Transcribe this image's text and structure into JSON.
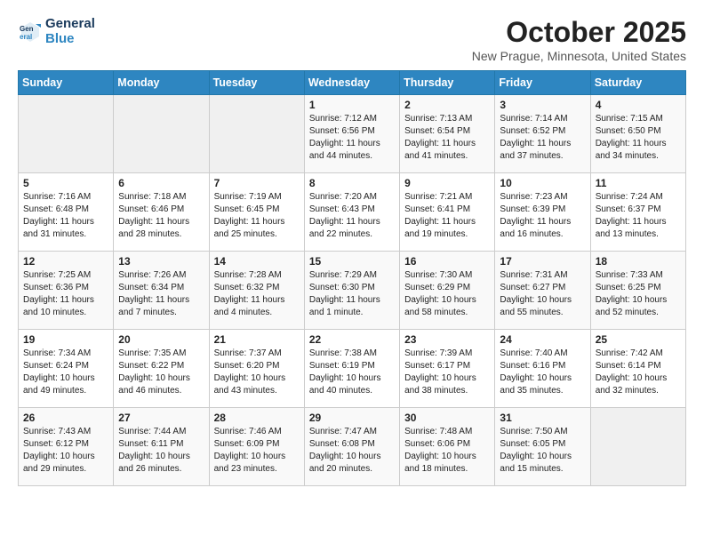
{
  "header": {
    "logo_line1": "General",
    "logo_line2": "Blue",
    "month_title": "October 2025",
    "location": "New Prague, Minnesota, United States"
  },
  "days_of_week": [
    "Sunday",
    "Monday",
    "Tuesday",
    "Wednesday",
    "Thursday",
    "Friday",
    "Saturday"
  ],
  "weeks": [
    [
      {
        "day": "",
        "info": ""
      },
      {
        "day": "",
        "info": ""
      },
      {
        "day": "",
        "info": ""
      },
      {
        "day": "1",
        "info": "Sunrise: 7:12 AM\nSunset: 6:56 PM\nDaylight: 11 hours\nand 44 minutes."
      },
      {
        "day": "2",
        "info": "Sunrise: 7:13 AM\nSunset: 6:54 PM\nDaylight: 11 hours\nand 41 minutes."
      },
      {
        "day": "3",
        "info": "Sunrise: 7:14 AM\nSunset: 6:52 PM\nDaylight: 11 hours\nand 37 minutes."
      },
      {
        "day": "4",
        "info": "Sunrise: 7:15 AM\nSunset: 6:50 PM\nDaylight: 11 hours\nand 34 minutes."
      }
    ],
    [
      {
        "day": "5",
        "info": "Sunrise: 7:16 AM\nSunset: 6:48 PM\nDaylight: 11 hours\nand 31 minutes."
      },
      {
        "day": "6",
        "info": "Sunrise: 7:18 AM\nSunset: 6:46 PM\nDaylight: 11 hours\nand 28 minutes."
      },
      {
        "day": "7",
        "info": "Sunrise: 7:19 AM\nSunset: 6:45 PM\nDaylight: 11 hours\nand 25 minutes."
      },
      {
        "day": "8",
        "info": "Sunrise: 7:20 AM\nSunset: 6:43 PM\nDaylight: 11 hours\nand 22 minutes."
      },
      {
        "day": "9",
        "info": "Sunrise: 7:21 AM\nSunset: 6:41 PM\nDaylight: 11 hours\nand 19 minutes."
      },
      {
        "day": "10",
        "info": "Sunrise: 7:23 AM\nSunset: 6:39 PM\nDaylight: 11 hours\nand 16 minutes."
      },
      {
        "day": "11",
        "info": "Sunrise: 7:24 AM\nSunset: 6:37 PM\nDaylight: 11 hours\nand 13 minutes."
      }
    ],
    [
      {
        "day": "12",
        "info": "Sunrise: 7:25 AM\nSunset: 6:36 PM\nDaylight: 11 hours\nand 10 minutes."
      },
      {
        "day": "13",
        "info": "Sunrise: 7:26 AM\nSunset: 6:34 PM\nDaylight: 11 hours\nand 7 minutes."
      },
      {
        "day": "14",
        "info": "Sunrise: 7:28 AM\nSunset: 6:32 PM\nDaylight: 11 hours\nand 4 minutes."
      },
      {
        "day": "15",
        "info": "Sunrise: 7:29 AM\nSunset: 6:30 PM\nDaylight: 11 hours\nand 1 minute."
      },
      {
        "day": "16",
        "info": "Sunrise: 7:30 AM\nSunset: 6:29 PM\nDaylight: 10 hours\nand 58 minutes."
      },
      {
        "day": "17",
        "info": "Sunrise: 7:31 AM\nSunset: 6:27 PM\nDaylight: 10 hours\nand 55 minutes."
      },
      {
        "day": "18",
        "info": "Sunrise: 7:33 AM\nSunset: 6:25 PM\nDaylight: 10 hours\nand 52 minutes."
      }
    ],
    [
      {
        "day": "19",
        "info": "Sunrise: 7:34 AM\nSunset: 6:24 PM\nDaylight: 10 hours\nand 49 minutes."
      },
      {
        "day": "20",
        "info": "Sunrise: 7:35 AM\nSunset: 6:22 PM\nDaylight: 10 hours\nand 46 minutes."
      },
      {
        "day": "21",
        "info": "Sunrise: 7:37 AM\nSunset: 6:20 PM\nDaylight: 10 hours\nand 43 minutes."
      },
      {
        "day": "22",
        "info": "Sunrise: 7:38 AM\nSunset: 6:19 PM\nDaylight: 10 hours\nand 40 minutes."
      },
      {
        "day": "23",
        "info": "Sunrise: 7:39 AM\nSunset: 6:17 PM\nDaylight: 10 hours\nand 38 minutes."
      },
      {
        "day": "24",
        "info": "Sunrise: 7:40 AM\nSunset: 6:16 PM\nDaylight: 10 hours\nand 35 minutes."
      },
      {
        "day": "25",
        "info": "Sunrise: 7:42 AM\nSunset: 6:14 PM\nDaylight: 10 hours\nand 32 minutes."
      }
    ],
    [
      {
        "day": "26",
        "info": "Sunrise: 7:43 AM\nSunset: 6:12 PM\nDaylight: 10 hours\nand 29 minutes."
      },
      {
        "day": "27",
        "info": "Sunrise: 7:44 AM\nSunset: 6:11 PM\nDaylight: 10 hours\nand 26 minutes."
      },
      {
        "day": "28",
        "info": "Sunrise: 7:46 AM\nSunset: 6:09 PM\nDaylight: 10 hours\nand 23 minutes."
      },
      {
        "day": "29",
        "info": "Sunrise: 7:47 AM\nSunset: 6:08 PM\nDaylight: 10 hours\nand 20 minutes."
      },
      {
        "day": "30",
        "info": "Sunrise: 7:48 AM\nSunset: 6:06 PM\nDaylight: 10 hours\nand 18 minutes."
      },
      {
        "day": "31",
        "info": "Sunrise: 7:50 AM\nSunset: 6:05 PM\nDaylight: 10 hours\nand 15 minutes."
      },
      {
        "day": "",
        "info": ""
      }
    ]
  ]
}
